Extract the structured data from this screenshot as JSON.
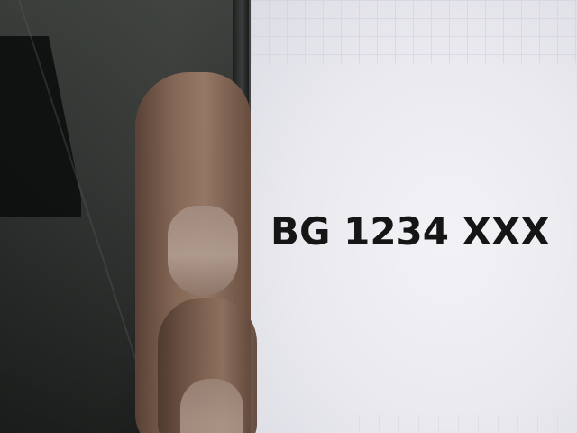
{
  "screen": {
    "plate_text": "BG 1234 XXX"
  },
  "colors": {
    "screen_background": "#ececf1",
    "plate_text": "#151515",
    "wall": "#2b2e2c"
  }
}
